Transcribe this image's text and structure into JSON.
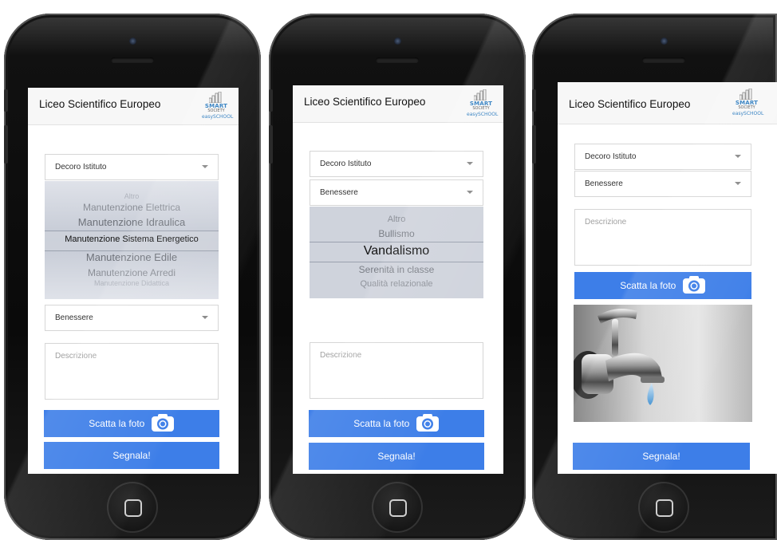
{
  "app": {
    "school_title": "Liceo Scientifico Europeo",
    "logo": {
      "line1": "SMART",
      "line2": "SOCIETY",
      "line3": "easySCHOOL"
    }
  },
  "form": {
    "category_select": "Decoro Istituto",
    "subcategory_select": "Benessere",
    "description_placeholder": "Descrizione",
    "photo_button": "Scatta la foto",
    "submit_button": "Segnala!"
  },
  "picker_decoro": {
    "options": [
      "Altro",
      "Manutenzione Elettrica",
      "Manutenzione Idraulica",
      "Manutenzione Sistema Energetico",
      "Manutenzione Edile",
      "Manutenzione Arredi",
      "Manutenzione Didattica"
    ],
    "selected": "Manutenzione Sistema Energetico"
  },
  "picker_benessere": {
    "options": [
      "Altro",
      "Bullismo",
      "Vandalismo",
      "Serenità in classe",
      "Qualità relazionale"
    ],
    "selected": "Vandalismo"
  },
  "icons": [
    "camera-icon",
    "home-button-icon",
    "logo-icon"
  ],
  "colors": {
    "accent": "#3d7ee8",
    "picker_bg": "#cfd3dc"
  }
}
